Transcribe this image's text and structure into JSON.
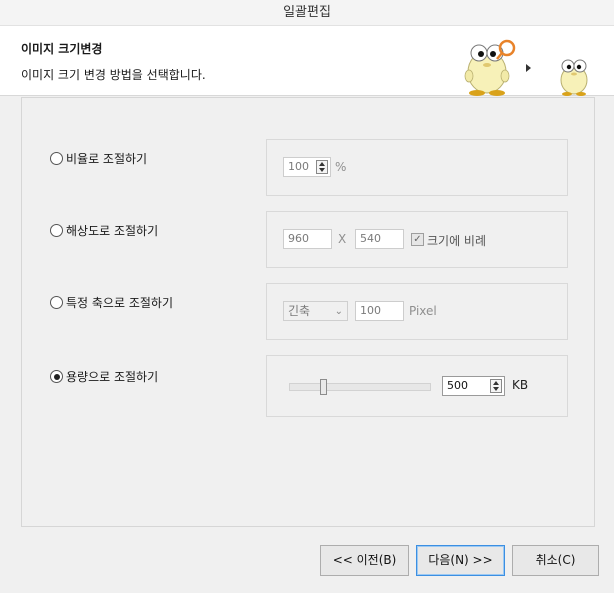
{
  "window": {
    "title": "일괄편집"
  },
  "header": {
    "title": "이미지 크기변경",
    "subtitle": "이미지 크기 변경 방법을 선택합니다.",
    "mascot_icon": "cartoon-egg-mascot"
  },
  "options": {
    "ratio": {
      "label": "비율로 조절하기",
      "checked": false,
      "value": "100",
      "unit": "%"
    },
    "resolution": {
      "label": "해상도로 조절하기",
      "checked": false,
      "width": "960",
      "separator": "X",
      "height": "540",
      "keep_ratio_label": "크기에 비례",
      "keep_ratio_checked": true
    },
    "axis": {
      "label": "특정 축으로 조절하기",
      "checked": false,
      "axis_select": "긴축",
      "value": "100",
      "unit": "Pixel"
    },
    "filesize": {
      "label": "용량으로 조절하기",
      "checked": true,
      "slider_level": 0.23,
      "value": "500",
      "unit": "KB"
    }
  },
  "footer": {
    "prev_label": "<< 이전(B)",
    "next_label": "다음(N) >>",
    "cancel_label": "취소(C)"
  }
}
